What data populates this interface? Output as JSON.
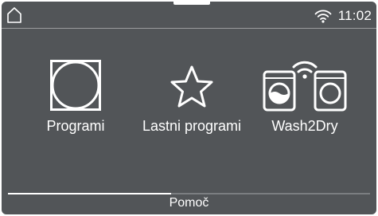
{
  "statusbar": {
    "home_icon": "home-icon",
    "wifi_icon": "wifi-icon",
    "time": "11:02"
  },
  "menu": {
    "items": [
      {
        "label": "Programi",
        "icon": "programs-icon"
      },
      {
        "label": "Lastni programi",
        "icon": "star-icon"
      },
      {
        "label": "Wash2Dry",
        "icon": "wash2dry-icon"
      }
    ]
  },
  "footer": {
    "help_label": "Pomoč",
    "page_progress": 0.45
  },
  "colors": {
    "background": "#525558",
    "foreground": "#ffffff"
  }
}
